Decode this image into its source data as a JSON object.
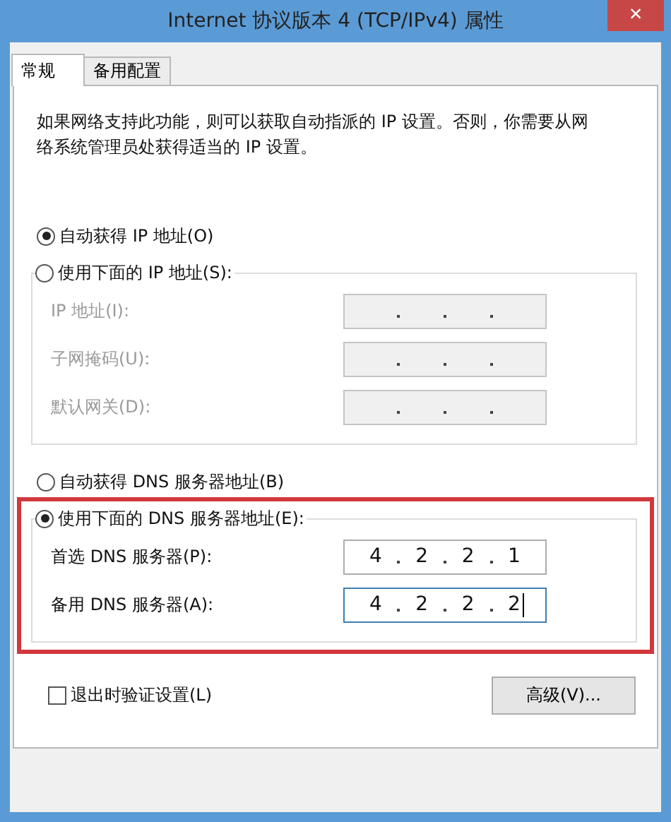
{
  "window": {
    "title": "Internet 协议版本 4 (TCP/IPv4) 属性",
    "close": "×"
  },
  "tabs": [
    {
      "label": "常规",
      "selected": true
    },
    {
      "label": "备用配置",
      "selected": false
    }
  ],
  "description": "如果网络支持此功能，则可以获取自动指派的 IP 设置。否则，你需要从网络系统管理员处获得适当的 IP 设置。",
  "ip_section": {
    "options": [
      {
        "label": "自动获得 IP 地址(O)",
        "selected": true
      },
      {
        "label": "使用下面的 IP 地址(S):",
        "selected": false
      }
    ],
    "disabled": true,
    "fields": [
      {
        "label": "IP 地址(I):",
        "focused": false
      },
      {
        "label": "子网掩码(U):",
        "focused": false
      },
      {
        "label": "默认网关(D):",
        "focused": false
      }
    ]
  },
  "dns_section": {
    "options": [
      {
        "label": "自动获得 DNS 服务器地址(B)",
        "selected": false
      },
      {
        "label": "使用下面的 DNS 服务器地址(E):",
        "selected": true
      }
    ],
    "disabled": false,
    "highlighted": true,
    "fields": [
      {
        "label": "首选 DNS 服务器(P):",
        "octets": [
          "4",
          "2",
          "2",
          "1"
        ],
        "focused": false
      },
      {
        "label": "备用 DNS 服务器(A):",
        "octets": [
          "4",
          "2",
          "2",
          "2"
        ],
        "focused": true
      }
    ]
  },
  "validate_checkbox": {
    "label": "退出时验证设置(L)",
    "checked": false
  },
  "advanced_button": "高级(V)..."
}
